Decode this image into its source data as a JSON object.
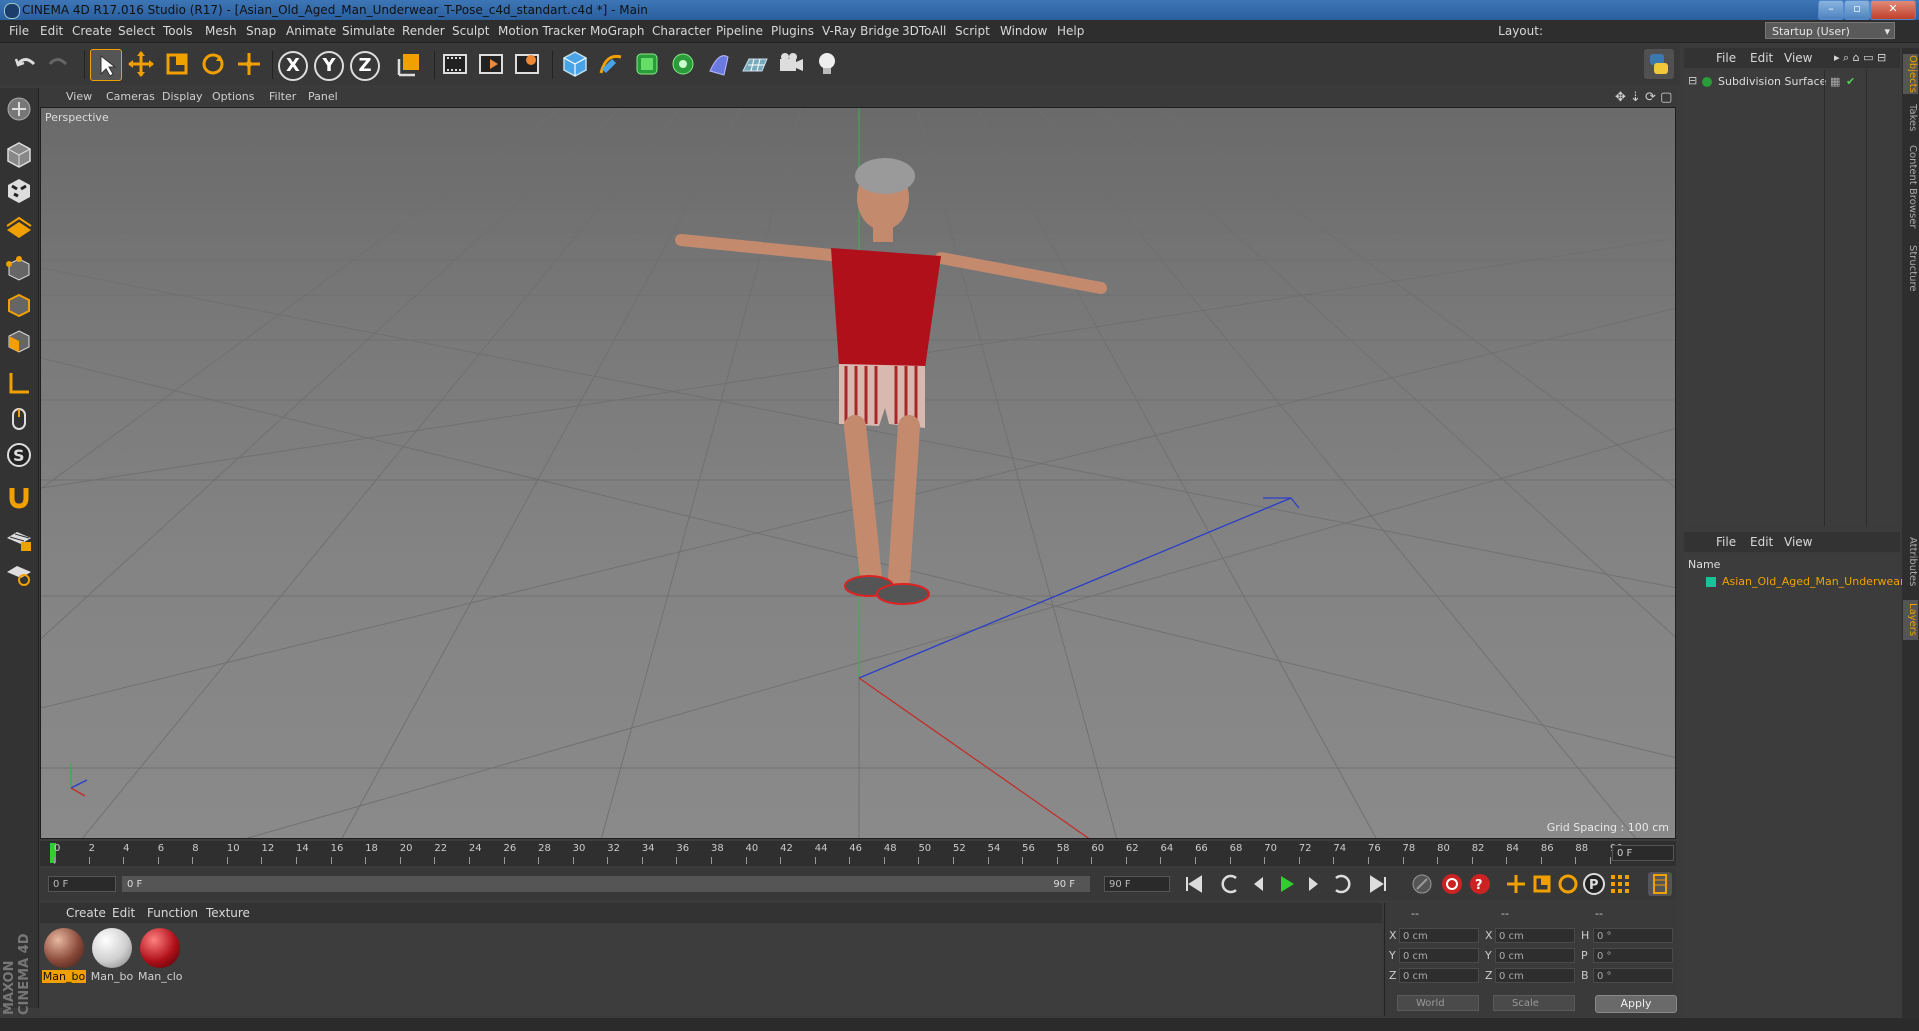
{
  "window": {
    "title": "CINEMA 4D R17.016 Studio (R17) - [Asian_Old_Aged_Man_Underwear_T-Pose_c4d_standart.c4d *] - Main",
    "controls": [
      "–",
      "▫",
      "✕"
    ]
  },
  "menubar": {
    "items": [
      "File",
      "Edit",
      "Create",
      "Select",
      "Tools",
      "Mesh",
      "Snap",
      "Animate",
      "Simulate",
      "Render",
      "Sculpt",
      "Motion Tracker",
      "MoGraph",
      "Character",
      "Pipeline",
      "Plugins",
      "V-Ray Bridge",
      "3DToAll",
      "Script",
      "Window",
      "Help"
    ],
    "layout_label": "Layout:",
    "layout_value": "Startup (User)"
  },
  "toolbar": {
    "axis_x": "X",
    "axis_y": "Y",
    "axis_z": "Z"
  },
  "viewport": {
    "menu": [
      "View",
      "Cameras",
      "Display",
      "Options",
      "Filter",
      "Panel"
    ],
    "label": "Perspective",
    "grid_spacing": "Grid Spacing : 100 cm"
  },
  "timeline": {
    "ticks": [
      "0",
      "2",
      "4",
      "6",
      "8",
      "10",
      "12",
      "14",
      "16",
      "18",
      "20",
      "22",
      "24",
      "26",
      "28",
      "30",
      "32",
      "34",
      "36",
      "38",
      "40",
      "42",
      "44",
      "46",
      "48",
      "50",
      "52",
      "54",
      "56",
      "58",
      "60",
      "62",
      "64",
      "66",
      "68",
      "70",
      "72",
      "74",
      "76",
      "78",
      "80",
      "82",
      "84",
      "86",
      "88",
      "90"
    ],
    "current_frame": "0 F",
    "start_field": "0 F",
    "range_start": "0 F",
    "range_end": "90 F",
    "end_field": "90 F"
  },
  "materials": {
    "menu": [
      "Create",
      "Edit",
      "Function",
      "Texture"
    ],
    "items": [
      {
        "label": "Man_bo",
        "color": "#8a4a3a"
      },
      {
        "label": "Man_bo",
        "color": "#cfcfcf"
      },
      {
        "label": "Man_clo",
        "color": "#b0101a"
      }
    ]
  },
  "coordinates": {
    "header": [
      "--",
      "--",
      "--"
    ],
    "rows": [
      {
        "a": "X",
        "av": "0 cm",
        "b": "X",
        "bv": "0 cm",
        "c": "H",
        "cv": "0 °"
      },
      {
        "a": "Y",
        "av": "0 cm",
        "b": "Y",
        "bv": "0 cm",
        "c": "P",
        "cv": "0 °"
      },
      {
        "a": "Z",
        "av": "0 cm",
        "b": "Z",
        "bv": "0 cm",
        "c": "B",
        "cv": "0 °"
      }
    ],
    "mode1": "World",
    "mode2": "Scale",
    "apply": "Apply"
  },
  "objects": {
    "menu": [
      "File",
      "Edit",
      "View"
    ],
    "items": [
      {
        "name": "Subdivision Surface"
      }
    ]
  },
  "layers": {
    "menu": [
      "File",
      "Edit",
      "View"
    ],
    "column": "Name",
    "items": [
      {
        "name": "Asian_Old_Aged_Man_Underwear",
        "color": "#19c39a"
      }
    ]
  },
  "right_tabs": [
    "Objects",
    "Takes",
    "Content Browser",
    "Structure",
    "Attributes",
    "Layers"
  ],
  "branding": {
    "text": "MAXON CINEMA 4D"
  },
  "colors": {
    "accent": "#f0a000",
    "layer_text": "#f0a000"
  }
}
